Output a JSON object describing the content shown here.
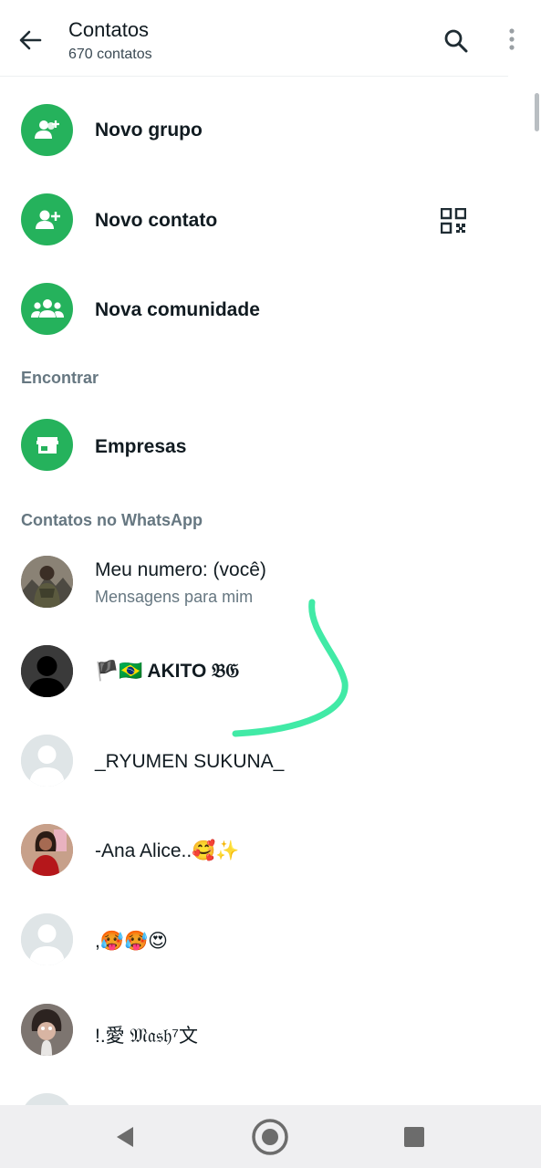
{
  "header": {
    "title": "Contatos",
    "subtitle": "670 contatos"
  },
  "actions": [
    {
      "label": "Novo grupo",
      "icon": "group-add-icon"
    },
    {
      "label": "Novo contato",
      "icon": "person-add-icon"
    },
    {
      "label": "Nova comunidade",
      "icon": "community-icon"
    }
  ],
  "sections": {
    "find": "Encontrar",
    "contacts": "Contatos no WhatsApp"
  },
  "business": {
    "label": "Empresas",
    "icon": "store-icon"
  },
  "contacts": [
    {
      "name": "Meu numero: (você)",
      "status": "Mensagens para mim"
    },
    {
      "name": "🏴🇧🇷 AKITO 𝔅𝔊"
    },
    {
      "name": "_RYUMEN SUKUNA_"
    },
    {
      "name": "-Ana Alice..🥰✨"
    },
    {
      "name": ",🥵🥵😍"
    },
    {
      "name": "!.愛 𝔐𝔞𝔰𝔥⁷文"
    }
  ],
  "colors": {
    "accent": "#25b25c",
    "annotation": "#41eaa6",
    "placeholder_avatar": "#dfe5e7"
  }
}
